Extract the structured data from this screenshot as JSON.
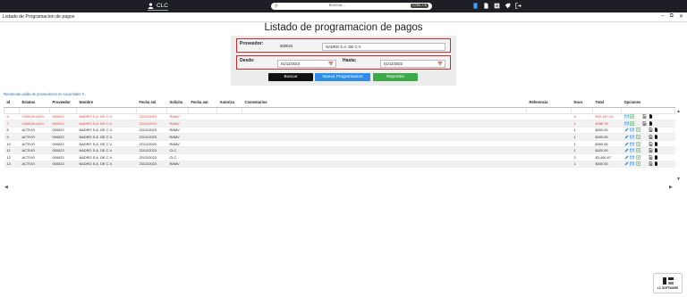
{
  "header": {
    "user_name": "CLC",
    "search_placeholder": "Buscar...",
    "search_shortcut": "CTRL + K"
  },
  "window": {
    "title": "Listado de Programacion de pagos"
  },
  "page": {
    "title": "Listado de programacion de pagos"
  },
  "filters": {
    "proveedor_label": "Proveedor:",
    "proveedor_code": "000023",
    "proveedor_name": "NADRO S.A. DE C.V.",
    "desde_label": "Desde:",
    "desde_value": "01/12/2023",
    "hasta_label": "Hasta:",
    "hasta_value": "01/12/2023"
  },
  "actions": {
    "buscar": "Buscar",
    "nueva": "Nueva Programacion",
    "reportes": "Reportes",
    "colors": {
      "buscar": "#111111",
      "nueva": "#2f8fe8",
      "reportes": "#3daa4a"
    }
  },
  "reload_link": "Recalcular saldo de proveedores en sucursales",
  "table": {
    "headers": {
      "id": "Id",
      "estatus": "Estatus",
      "proveedor": "Proveedor",
      "nombre": "Nombre",
      "fecha_sol": "Fecha sol",
      "solicita": "Solicita",
      "fecha_aut": "Fecha aut",
      "autoriza": "Autoriza",
      "comentarios": "Comentarios",
      "referencia": "Referencia",
      "docs": "Docs",
      "total": "Total",
      "opciones": "Opciones"
    },
    "rows": [
      {
        "id": "6",
        "estatus": "CANCELADO",
        "proveedor": "000023",
        "nombre": "NADRO S.A. DE C.V.",
        "fecha_sol": "22/12/2023",
        "solicita": "RAMV",
        "docs": "6",
        "total": "$32,147.23",
        "cancelled": true
      },
      {
        "id": "7",
        "estatus": "CANCELADO",
        "proveedor": "000023",
        "nombre": "NADRO S.A. DE C.V.",
        "fecha_sol": "22/12/2023",
        "solicita": "RAMV",
        "docs": "1",
        "total": "$388.78",
        "cancelled": true
      },
      {
        "id": "8",
        "estatus": "ACTIVO",
        "proveedor": "000023",
        "nombre": "NADRO S.A. DE C.V.",
        "fecha_sol": "22/12/2023",
        "solicita": "RAMV",
        "docs": "1",
        "total": "$200.00",
        "cancelled": false
      },
      {
        "id": "9",
        "estatus": "ACTIVO",
        "proveedor": "000023",
        "nombre": "NADRO S.A. DE C.V.",
        "fecha_sol": "22/12/2023",
        "solicita": "RAMV",
        "docs": "1",
        "total": "$400.00",
        "cancelled": false
      },
      {
        "id": "10",
        "estatus": "ACTIVO",
        "proveedor": "000023",
        "nombre": "NADRO S.A. DE C.V.",
        "fecha_sol": "22/12/2023",
        "solicita": "RAMV",
        "docs": "1",
        "total": "$400.00",
        "cancelled": false
      },
      {
        "id": "11",
        "estatus": "ACTIVO",
        "proveedor": "000023",
        "nombre": "NADRO S.A. DE C.V.",
        "fecha_sol": "22/12/2023",
        "solicita": "CLC",
        "docs": "1",
        "total": "$420.00",
        "cancelled": false
      },
      {
        "id": "12",
        "estatus": "ACTIVO",
        "proveedor": "000023",
        "nombre": "NADRO S.A. DE C.V.",
        "fecha_sol": "22/12/2023",
        "solicita": "CLC",
        "docs": "2",
        "total": "$3,400.47",
        "cancelled": false
      },
      {
        "id": "13",
        "estatus": "ACTIVO",
        "proveedor": "000023",
        "nombre": "NADRO S.A. DE C.V.",
        "fecha_sol": "23/12/2023",
        "solicita": "RAMV",
        "docs": "1",
        "total": "$300.00",
        "cancelled": false
      }
    ]
  },
  "logo_text": "LC SOFTWARE"
}
